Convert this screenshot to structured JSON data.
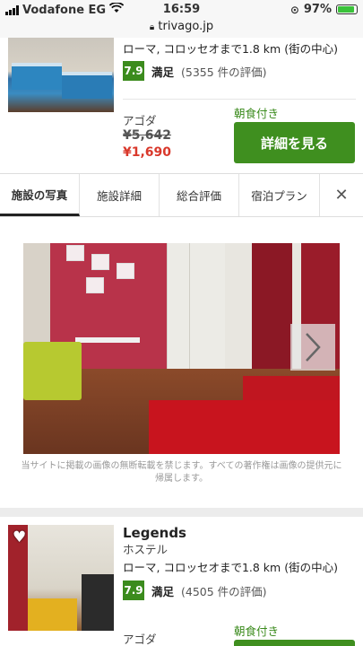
{
  "status_bar": {
    "carrier": "Vodafone EG",
    "time": "16:59",
    "battery": "97%",
    "url": "trivago.jp"
  },
  "hotel1": {
    "location": "ローマ, コロッセオまで1.8 km (街の中心)",
    "score": "7.9",
    "score_label": "満足",
    "review_count": "(5355 件の評価)",
    "provider": "アゴダ",
    "old_price": "¥5,642",
    "new_price": "¥1,690",
    "breakfast": "朝食付き",
    "button_label": "詳細を見る"
  },
  "tabs": [
    {
      "label": "施設の写真",
      "active": true
    },
    {
      "label": "施設詳細",
      "active": false
    },
    {
      "label": "総合評価",
      "active": false
    },
    {
      "label": "宿泊プラン",
      "active": false
    }
  ],
  "tabs_close": "✕",
  "gallery": {
    "credit": "当サイトに掲載の画像の無断転載を禁じます。すべての著作権は画像の提供元に帰属します。"
  },
  "hotel2": {
    "name": "Legends",
    "type": "ホステル",
    "location": "ローマ, コロッセオまで1.8 km (街の中心)",
    "score": "7.9",
    "score_label": "満足",
    "review_count": "(4505 件の評価)",
    "provider": "アゴダ",
    "breakfast": "朝食付き"
  },
  "colors": {
    "score_bg": "#3b8b1d",
    "button_bg": "#3f8f1f",
    "price_red": "#d9382b",
    "breakfast_green": "#3b8b1d"
  },
  "icons": [
    "signal-icon",
    "wifi-icon",
    "lock-icon",
    "location-arrow-icon",
    "battery-icon",
    "close-icon",
    "chevron-right-icon",
    "heart-icon"
  ]
}
